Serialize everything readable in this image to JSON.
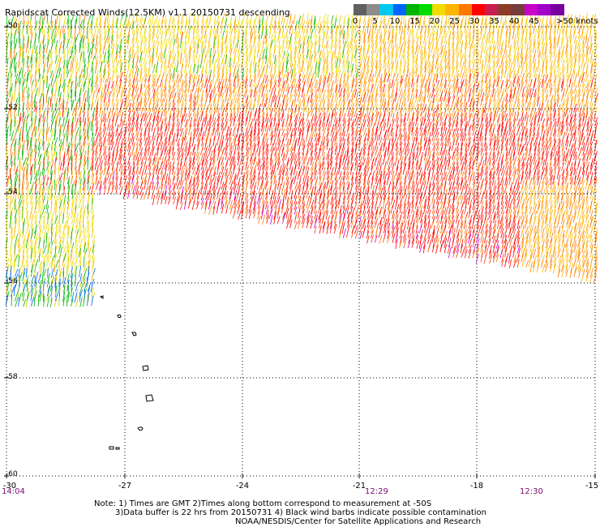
{
  "title": "Rapidscat Corrected Winds(12.5KM) v1.1 20150731 descending",
  "legend": {
    "colors": [
      "#606060",
      "#8c8c8c",
      "#00c8f0",
      "#0064ff",
      "#00b400",
      "#00dc00",
      "#f0dc00",
      "#ffb400",
      "#ff7800",
      "#ff0000",
      "#c81e50",
      "#8c3c28",
      "#783c3c",
      "#c800c8",
      "#a000c8",
      "#7800a0"
    ],
    "labels": [
      "0",
      "5",
      "10",
      "15",
      "20",
      "25",
      "30",
      "35",
      "40",
      "45",
      ">50 knots"
    ]
  },
  "lat_labels": [
    "-50",
    "-52",
    "-54",
    "-56",
    "-58",
    "-60"
  ],
  "lon_labels": [
    "-30",
    "-27",
    "-24",
    "-21",
    "-18",
    "-15"
  ],
  "time_labels": [
    "14:04",
    "12:29",
    "12:30"
  ],
  "notes": [
    "Note: 1) Times are GMT 2)Times along bottom correspond to measurement at -50S",
    "3)Data buffer is 22 hrs from 20150731 4) Black wind barbs indicate possible contamination",
    "NOAA/NESDIS/Center for Satellite Applications and Research"
  ]
}
